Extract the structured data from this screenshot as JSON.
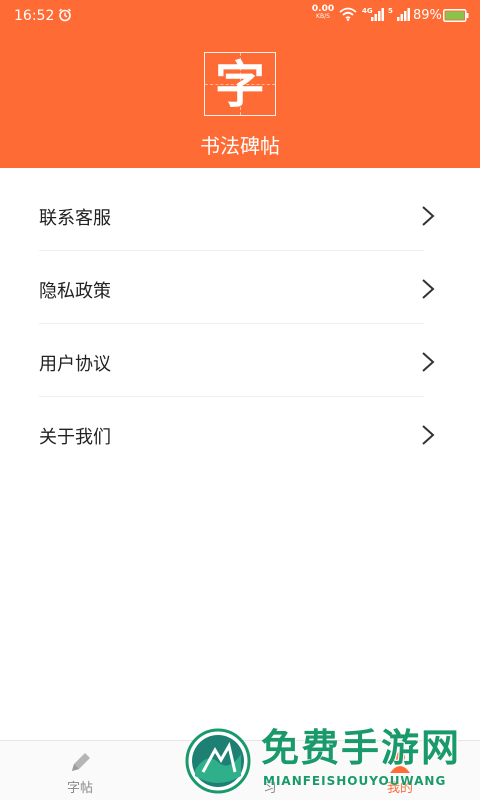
{
  "status_bar": {
    "time": "16:52",
    "net_speed_value": "0.00",
    "net_speed_unit": "KB/S",
    "signal_1_label": "4G",
    "signal_2_label": "5",
    "battery": "89%"
  },
  "header": {
    "logo_char": "字",
    "app_title": "书法碑帖",
    "background_color": "#ff6b35"
  },
  "menu": {
    "items": [
      {
        "label": "联系客服"
      },
      {
        "label": "隐私政策"
      },
      {
        "label": "用户协议"
      },
      {
        "label": "关于我们"
      }
    ]
  },
  "tab_bar": {
    "tabs": [
      {
        "label": "字帖",
        "icon": "pencil-icon",
        "active": false
      },
      {
        "label": "习",
        "icon": "practice-icon",
        "active": false
      },
      {
        "label": "我的",
        "icon": "profile-icon",
        "active": true
      }
    ]
  },
  "watermark": {
    "title": "免费手游网",
    "subtitle": "MIANFEISHOUYOUWANG"
  }
}
